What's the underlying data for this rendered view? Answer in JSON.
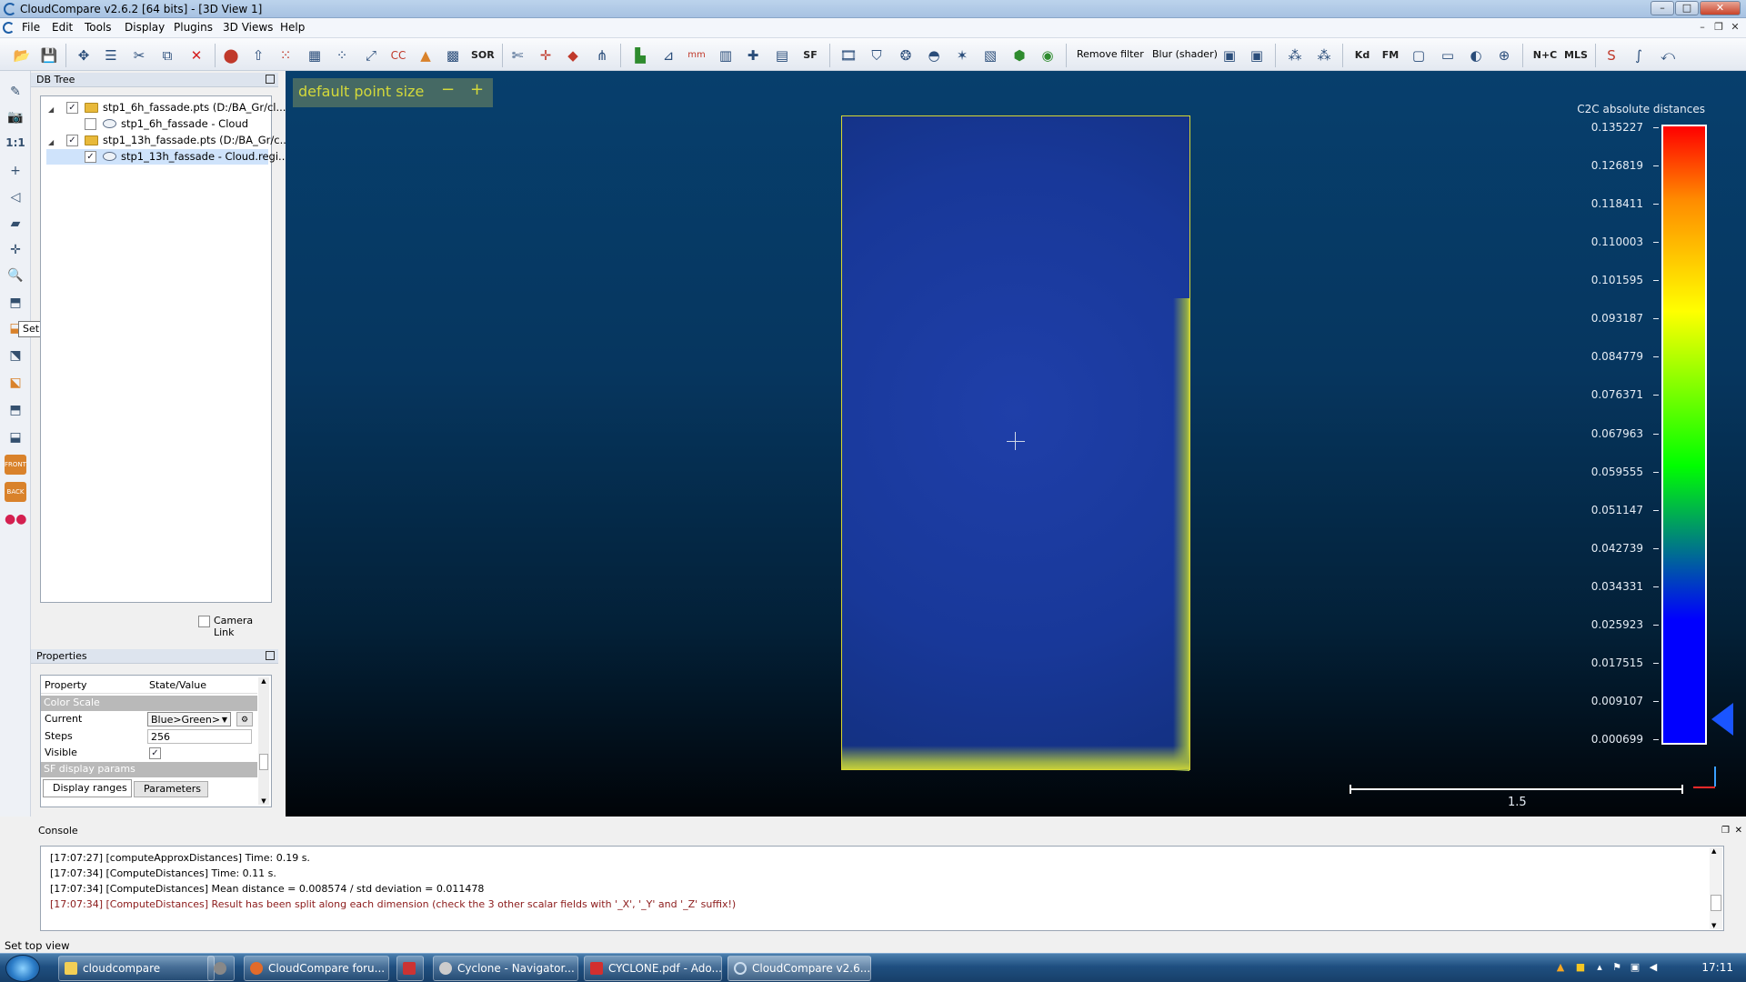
{
  "window": {
    "title": "CloudCompare v2.6.2 [64 bits] - [3D View 1]"
  },
  "menu": [
    "File",
    "Edit",
    "Tools",
    "Display",
    "Plugins",
    "3D Views",
    "Help"
  ],
  "toolbar": {
    "remove_filter": "Remove filter",
    "blur_shader": "Blur (shader)",
    "sor": "SOR",
    "sf": "SF",
    "kd": "Kd",
    "fm": "FM",
    "mls": "MLS",
    "ntc": "N+C"
  },
  "vtool": {
    "tooltip": "Set top view",
    "one_to_one": "1:1",
    "front": "FRONT",
    "back": "BACK"
  },
  "dbtree": {
    "title": "DB Tree",
    "items": [
      {
        "label": "stp1_6h_fassade.pts (D:/BA_Gr/cl...",
        "checked": "✓"
      },
      {
        "label": "stp1_6h_fassade - Cloud",
        "checked": ""
      },
      {
        "label": "stp1_13h_fassade.pts (D:/BA_Gr/c...",
        "checked": "✓"
      },
      {
        "label": "stp1_13h_fassade - Cloud.regi...",
        "checked": "✓"
      }
    ],
    "camera_link": "Camera Link"
  },
  "properties": {
    "title": "Properties",
    "col_property": "Property",
    "col_value": "State/Value",
    "section_color_scale": "Color Scale",
    "current_label": "Current",
    "current_value": "Blue>Green>",
    "steps_label": "Steps",
    "steps_value": "256",
    "visible_label": "Visible",
    "visible_value": "✓",
    "section_sf": "SF display params",
    "tab_display_ranges": "Display ranges",
    "tab_parameters": "Parameters"
  },
  "view3d": {
    "point_size_label": "default point size",
    "minus": "−",
    "plus": "+",
    "scale_title": "C2C absolute distances",
    "scale_ticks": [
      "0.135227",
      "0.126819",
      "0.118411",
      "0.110003",
      "0.101595",
      "0.093187",
      "0.084779",
      "0.076371",
      "0.067963",
      "0.059555",
      "0.051147",
      "0.042739",
      "0.034331",
      "0.025923",
      "0.017515",
      "0.009107",
      "0.000699"
    ],
    "length_scale": "1.5"
  },
  "console": {
    "title": "Console",
    "lines": [
      "[17:07:27] [computeApproxDistances] Time: 0.19 s.",
      "[17:07:34] [ComputeDistances] Time: 0.11 s.",
      "[17:07:34] [ComputeDistances] Mean distance = 0.008574 / std deviation = 0.011478",
      "[17:07:34] [ComputeDistances] Result has been split along each dimension (check the 3 other scalar fields with '_X', '_Y' and '_Z' suffix!)"
    ]
  },
  "status": "Set top view",
  "taskbar": {
    "items": [
      "cloudcompare",
      "CloudCompare foru...",
      "Cyclone - Navigator...",
      "CYCLONE.pdf - Ado...",
      "CloudCompare v2.6...."
    ],
    "clock": "17:11"
  },
  "colors": {
    "scale_top": "#ff0000",
    "scale_bottom": "#0000ff",
    "bbox": "#d8d832",
    "error_text": "#8b1a1a"
  }
}
